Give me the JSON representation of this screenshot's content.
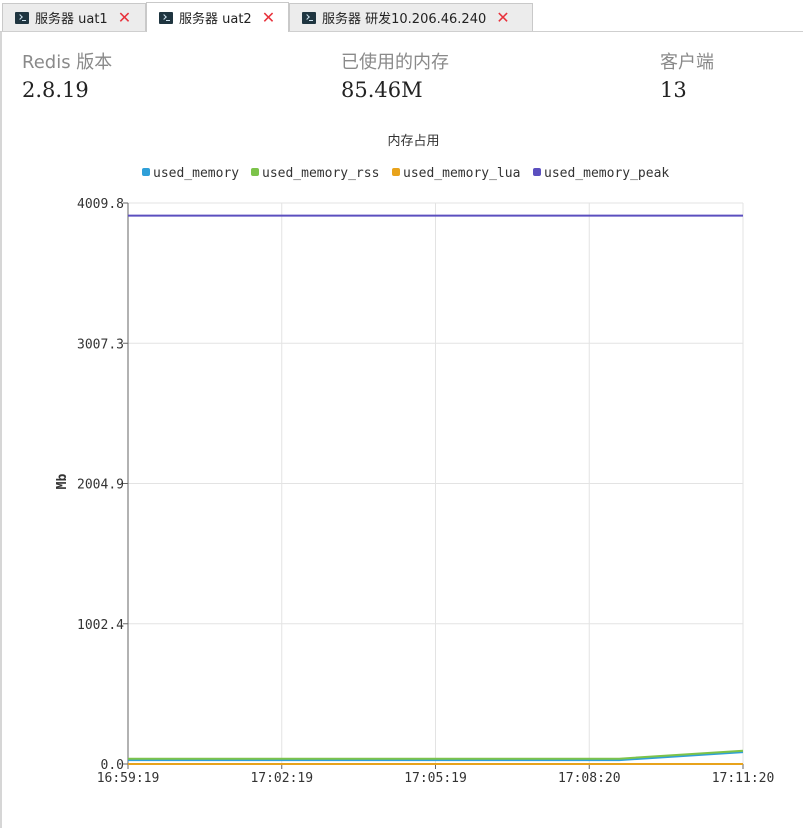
{
  "tabs": [
    {
      "label": "服务器 uat1",
      "active": false
    },
    {
      "label": "服务器 uat2",
      "active": true
    },
    {
      "label": "服务器 研发10.206.46.240",
      "active": false
    }
  ],
  "stats": {
    "version_label": "Redis 版本",
    "version_value": "2.8.19",
    "memory_label": "已使用的内存",
    "memory_value": "85.46M",
    "clients_label": "客户端",
    "clients_value": "13"
  },
  "chart_data": {
    "type": "line",
    "title": "内存占用",
    "ylabel": "Mb",
    "ylim": [
      0,
      4009.8
    ],
    "yticks": [
      "0.0",
      "1002.4",
      "2004.9",
      "3007.3",
      "4009.8"
    ],
    "x": [
      "16:59:19",
      "17:02:19",
      "17:05:19",
      "17:08:20",
      "17:11:20"
    ],
    "legend_position": "top",
    "grid": true,
    "series": [
      {
        "name": "used_memory",
        "color": "#2f9fd8",
        "values": [
          28,
          28,
          28,
          28,
          85
        ]
      },
      {
        "name": "used_memory_rss",
        "color": "#7cc34a",
        "values": [
          38,
          38,
          38,
          38,
          95
        ]
      },
      {
        "name": "used_memory_lua",
        "color": "#e8a31c",
        "values": [
          0.04,
          0.04,
          0.04,
          0.04,
          0.04
        ]
      },
      {
        "name": "used_memory_peak",
        "color": "#5b4fbf",
        "values": [
          3920,
          3920,
          3920,
          3920,
          3920
        ]
      }
    ]
  }
}
